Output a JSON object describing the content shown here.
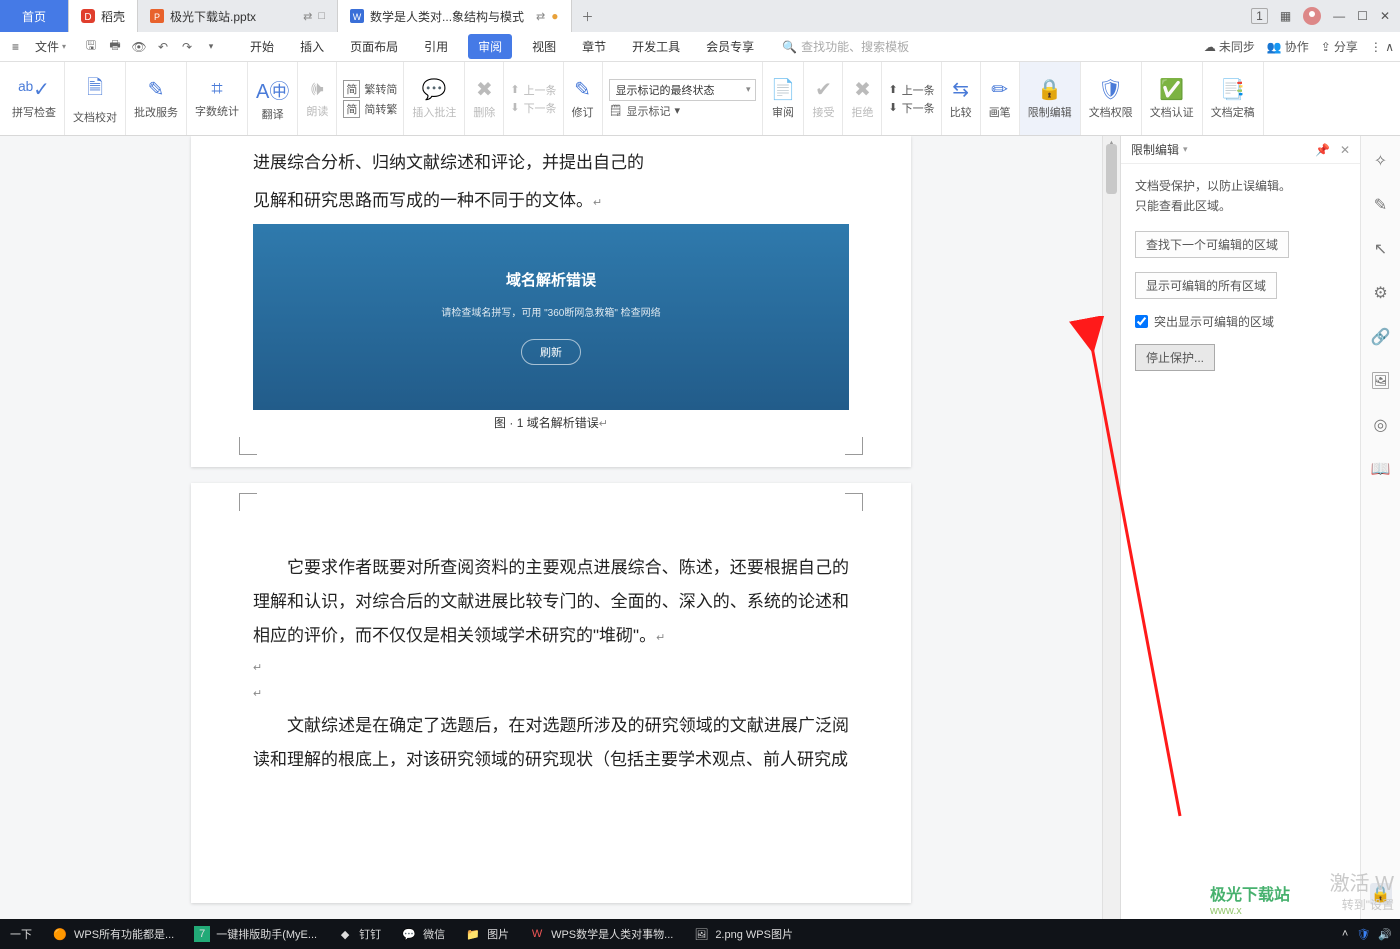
{
  "tab_home": "首页",
  "tab_docer": "稻壳",
  "tab_pptx": "极光下载站.pptx",
  "tab_active": "数学是人类对...象结构与模式",
  "menu_file": "文件",
  "ribbon_tabs": [
    "开始",
    "插入",
    "页面布局",
    "引用",
    "审阅",
    "视图",
    "章节",
    "开发工具",
    "会员专享"
  ],
  "search_placeholder": "查找功能、搜索模板",
  "mr_sync": "未同步",
  "mr_coop": "协作",
  "mr_share": "分享",
  "rb": {
    "spell": "拼写检查",
    "proof": "文档校对",
    "service": "批改服务",
    "wordcount": "字数统计",
    "translate": "翻译",
    "read": "朗读",
    "simp1": "繁转简",
    "simp2": "简转繁",
    "simp_icon": "简",
    "insert_comment": "插入批注",
    "delete": "删除",
    "prev": "上一条",
    "next": "下一条",
    "revise": "修订",
    "display_state": "显示标记的最终状态",
    "show_marks": "显示标记",
    "review": "审阅",
    "accept": "接受",
    "reject": "拒绝",
    "prev2": "上一条",
    "next2": "下一条",
    "compare": "比较",
    "pen": "画笔",
    "restrict": "限制编辑",
    "perm": "文档权限",
    "cert": "文档认证",
    "finalize": "文档定稿"
  },
  "panel": {
    "title": "限制编辑",
    "line1": "文档受保护，以防止误编辑。",
    "line2": "只能查看此区域。",
    "btn_find": "查找下一个可编辑的区域",
    "btn_show": "显示可编辑的所有区域",
    "chk_highlight": "突出显示可编辑的区域",
    "btn_stop": "停止保护..."
  },
  "doc": {
    "p1a": "进展综合分析、归纳文献综述和评论，并提出自己的",
    "p1b": "见解和研究思路而写成的一种不同于的文体。",
    "fig_title": "域名解析错误",
    "fig_sub": "请检查域名拼写，可用 \"360断网急救箱\" 检查网络",
    "fig_btn": "刷新",
    "fig_caption": "图 · 1 域名解析错误",
    "p2": "它要求作者既要对所查阅资料的主要观点进展综合、陈述，还要根据自己的理解和认识，对综合后的文献进展比较专门的、全面的、深入的、系统的论述和相应的评价，而不仅仅是相关领域学术研究的\"堆砌\"。",
    "p3": "文献综述是在确定了选题后，在对选题所涉及的研究领域的文献进展广泛阅读和理解的根底上，对该研究领域的研究现状（包括主要学术观点、前人研究成"
  },
  "wm_activate": "激活 W",
  "wm_goto": "转到\"设置",
  "taskbar": {
    "t0": "一下",
    "t1": "WPS所有功能都是...",
    "t2": "一键排版助手(MyE...",
    "t3": "钉钉",
    "t4": "微信",
    "t5": "图片",
    "t6": "WPS数学是人类对事物...",
    "t7": "2.png  WPS图片"
  }
}
